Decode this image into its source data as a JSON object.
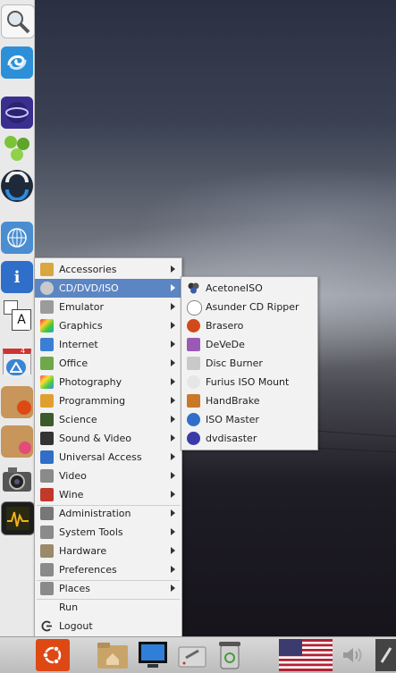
{
  "dock": {
    "items": [
      {
        "name": "magnifier-app-icon"
      },
      {
        "name": "swirl-app-icon"
      },
      {
        "name": "eclipse-app-icon"
      },
      {
        "name": "hexagon-molecule-icon"
      },
      {
        "name": "sync-app-icon"
      },
      {
        "name": "united-nations-icon"
      },
      {
        "name": "info-icon"
      },
      {
        "name": "font-viewer-icon",
        "glyph": "A"
      },
      {
        "name": "calendar-icon",
        "badge": "4"
      },
      {
        "name": "ubuntu-package-icon"
      },
      {
        "name": "media-package-icon"
      },
      {
        "name": "camera-icon"
      },
      {
        "name": "system-monitor-icon"
      }
    ]
  },
  "main_menu": {
    "items": [
      {
        "label": "Accessories",
        "icon": "accessories-icon",
        "submenu": true
      },
      {
        "label": "CD/DVD/ISO",
        "icon": "disc-icon",
        "submenu": true,
        "active": true
      },
      {
        "label": "Emulator",
        "icon": "emulator-icon",
        "submenu": true
      },
      {
        "label": "Graphics",
        "icon": "graphics-icon",
        "submenu": true
      },
      {
        "label": "Internet",
        "icon": "internet-icon",
        "submenu": true
      },
      {
        "label": "Office",
        "icon": "office-icon",
        "submenu": true
      },
      {
        "label": "Photography",
        "icon": "photography-icon",
        "submenu": true
      },
      {
        "label": "Programming",
        "icon": "programming-icon",
        "submenu": true
      },
      {
        "label": "Science",
        "icon": "science-icon",
        "submenu": true
      },
      {
        "label": "Sound & Video",
        "icon": "sound-video-icon",
        "submenu": true
      },
      {
        "label": "Universal Access",
        "icon": "universal-access-icon",
        "submenu": true
      },
      {
        "label": "Video",
        "icon": "video-icon",
        "submenu": true
      },
      {
        "label": "Wine",
        "icon": "wine-icon",
        "submenu": true
      },
      {
        "label": "Administration",
        "icon": "administration-icon",
        "submenu": true
      },
      {
        "label": "System Tools",
        "icon": "system-tools-icon",
        "submenu": true
      },
      {
        "label": "Hardware",
        "icon": "hardware-icon",
        "submenu": true
      },
      {
        "label": "Preferences",
        "icon": "preferences-icon",
        "submenu": true
      },
      {
        "label": "Places",
        "icon": "places-icon",
        "submenu": true
      },
      {
        "label": "Run",
        "icon": "",
        "submenu": false
      },
      {
        "label": "Logout",
        "icon": "logout-icon",
        "submenu": false
      }
    ]
  },
  "submenu": {
    "items": [
      {
        "label": "AcetoneISO",
        "icon": "acetoneiso-icon"
      },
      {
        "label": "Asunder CD Ripper",
        "icon": "asunder-icon"
      },
      {
        "label": "Brasero",
        "icon": "brasero-icon"
      },
      {
        "label": "DeVeDe",
        "icon": "devede-icon"
      },
      {
        "label": "Disc Burner",
        "icon": "disc-burner-icon"
      },
      {
        "label": "Furius ISO Mount",
        "icon": "furius-icon"
      },
      {
        "label": "HandBrake",
        "icon": "handbrake-icon"
      },
      {
        "label": "ISO Master",
        "icon": "iso-master-icon"
      },
      {
        "label": "dvdisaster",
        "icon": "dvdisaster-icon"
      }
    ]
  },
  "panel": {
    "buttons": [
      {
        "name": "ubuntu-menu-button"
      },
      {
        "name": "home-folder-icon"
      },
      {
        "name": "show-desktop-icon"
      },
      {
        "name": "settings-tools-icon"
      },
      {
        "name": "trash-icon"
      },
      {
        "name": "us-flag-keyboard-icon"
      },
      {
        "name": "volume-icon"
      },
      {
        "name": "pen-icon"
      }
    ]
  },
  "colors": {
    "menu_highlight": "#5c86c3",
    "menu_bg": "#f2f2f2",
    "dock_bg": "#e9e9e9",
    "ubuntu_orange": "#dd4814"
  }
}
